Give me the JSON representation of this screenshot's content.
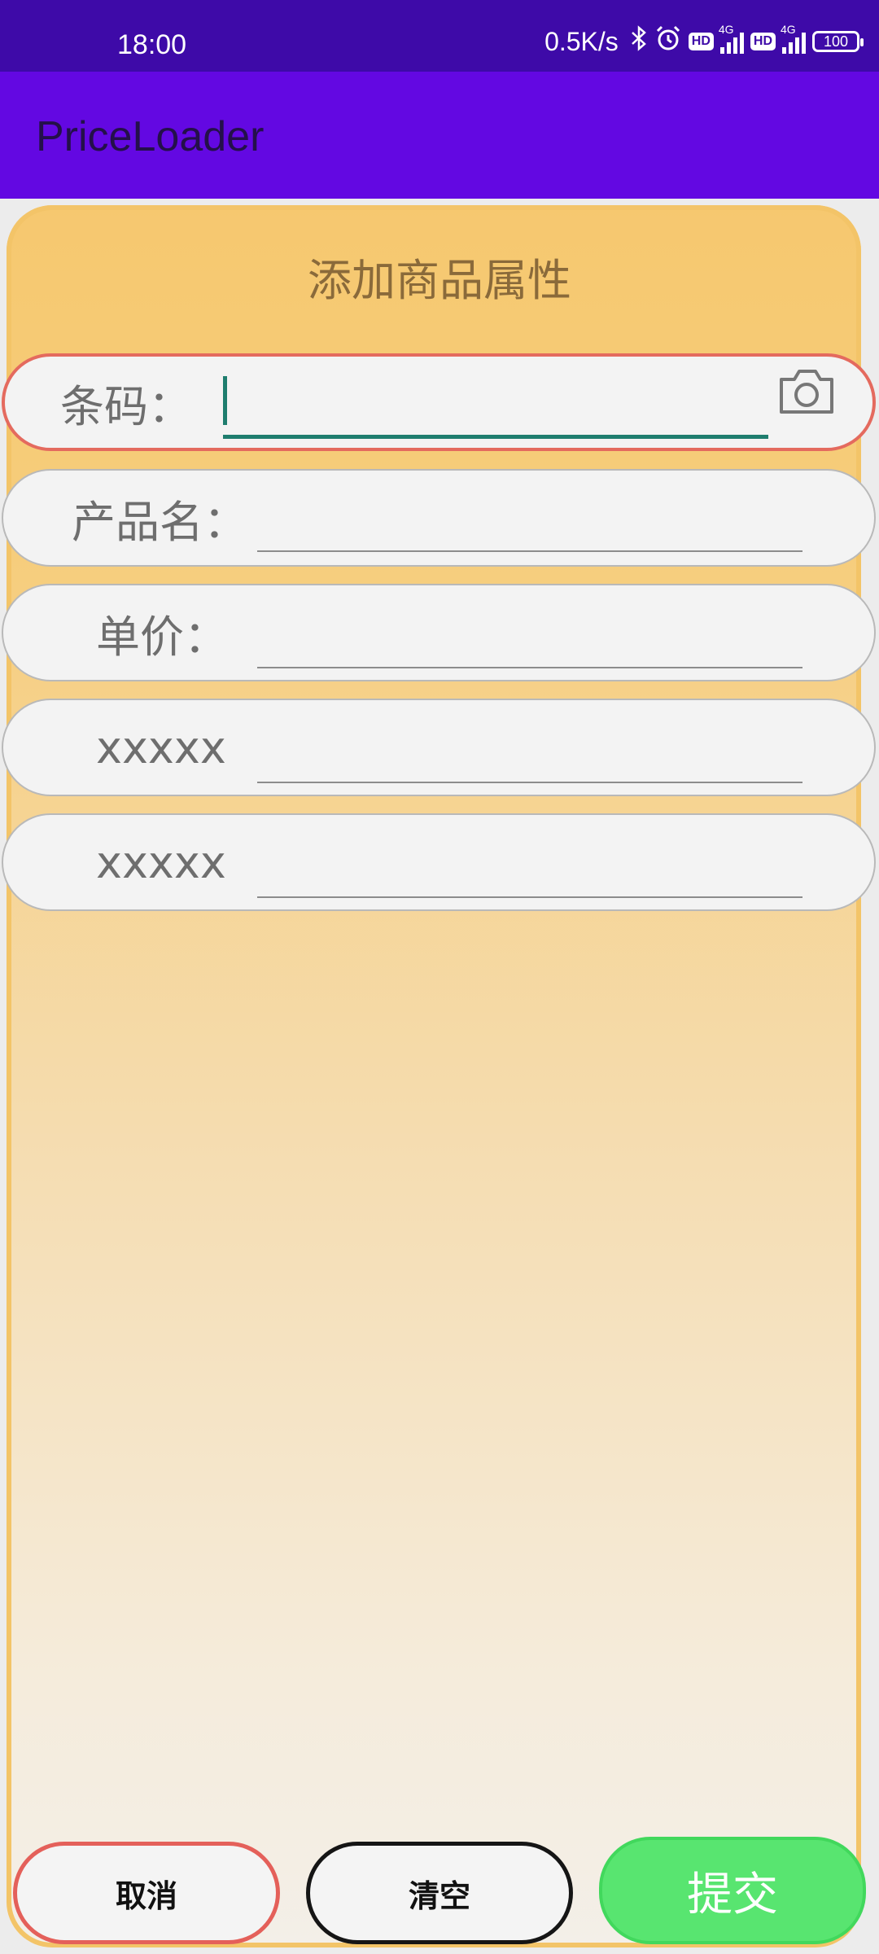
{
  "status_bar": {
    "time": "18:00",
    "net_speed": "0.5K/s",
    "icons": [
      "bluetooth-icon",
      "alarm-icon",
      "hd-icon",
      "signal-4g-icon",
      "hd-icon",
      "signal-4g-icon",
      "battery-icon"
    ],
    "hd_label": "HD",
    "network_label": "4G",
    "battery_level": "100"
  },
  "app_bar": {
    "title": "PriceLoader"
  },
  "form": {
    "title": "添加商品属性",
    "fields": [
      {
        "label": "条码：",
        "value": "",
        "active": true,
        "icon": "camera-icon"
      },
      {
        "label": "产品名：",
        "value": ""
      },
      {
        "label": "单价：",
        "value": ""
      },
      {
        "label": "xxxxx",
        "value": ""
      },
      {
        "label": "xxxxx",
        "value": ""
      }
    ]
  },
  "buttons": {
    "cancel": "取消",
    "clear": "清空",
    "submit": "提交"
  },
  "colors": {
    "status_bar": "#3e0aa8",
    "app_bar": "#6308e2",
    "active_border": "#e46a5e",
    "active_underline": "#1e7d6e",
    "submit_button": "#58e570"
  }
}
